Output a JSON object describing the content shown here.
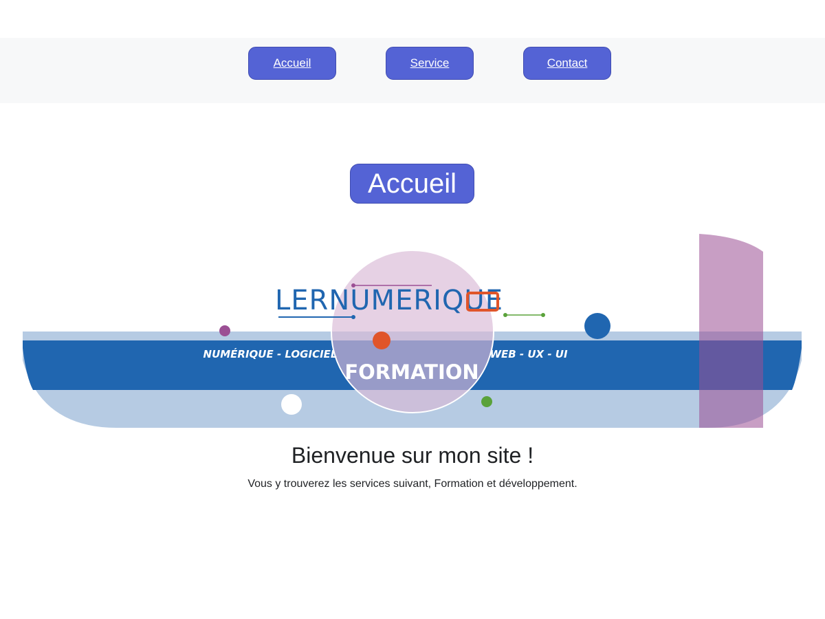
{
  "nav": {
    "items": [
      {
        "label": "Accueil"
      },
      {
        "label": "Service"
      },
      {
        "label": "Contact"
      }
    ]
  },
  "page": {
    "heading": "Accueil",
    "welcome_title": "Bienvenue sur mon site !",
    "welcome_text": "Vous y trouverez les services suivant, Formation et développement."
  },
  "banner": {
    "logo_text": "LERNUMERIQUE",
    "tagline_left": "NUMÉRIQUE - LOGICIEL",
    "tagline_right": "WEB - UX - UI",
    "main_text": "FORMATION"
  },
  "colors": {
    "button": "#5463d5",
    "band_dark": "#2066b0",
    "band_light": "#b6cbe3",
    "purple": "#c89bc3",
    "orange": "#e0552a",
    "green": "#5aa23a"
  }
}
